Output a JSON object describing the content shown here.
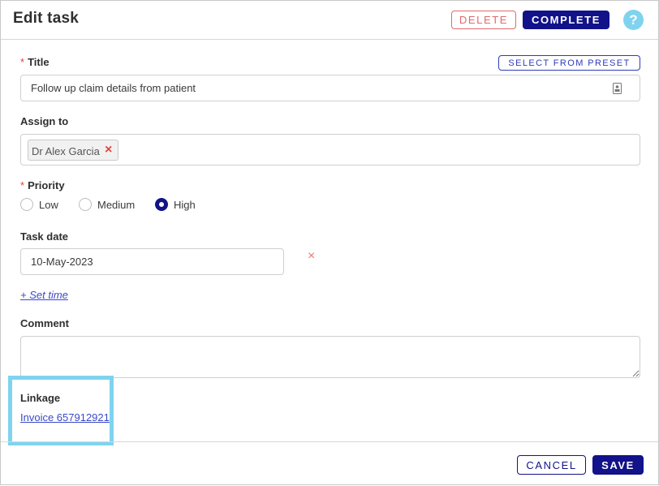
{
  "header": {
    "title": "Edit task",
    "delete_label": "DELETE",
    "complete_label": "COMPLETE",
    "help_label": "?"
  },
  "form": {
    "title_field": {
      "label": "Title",
      "preset_label": "SELECT FROM PRESET",
      "value": "Follow up claim details from patient"
    },
    "assign": {
      "label": "Assign to",
      "chip": "Dr Alex Garcia",
      "chip_remove": "×"
    },
    "priority": {
      "label": "Priority",
      "options": [
        {
          "label": "Low",
          "checked": false
        },
        {
          "label": "Medium",
          "checked": false
        },
        {
          "label": "High",
          "checked": true
        }
      ]
    },
    "task_date": {
      "label": "Task date",
      "value": "10-May-2023",
      "clear": "×"
    },
    "set_time_label": "+ Set time",
    "comment": {
      "label": "Comment",
      "value": ""
    },
    "linkage": {
      "label": "Linkage",
      "link": "Invoice 657912921"
    },
    "required_marker": "*"
  },
  "footer": {
    "cancel_label": "CANCEL",
    "save_label": "SAVE"
  },
  "colors": {
    "primary": "#12128a",
    "danger": "#e06a6a",
    "link": "#3949c9",
    "help": "#7fd3ef",
    "highlight": "#7fd3ef"
  }
}
